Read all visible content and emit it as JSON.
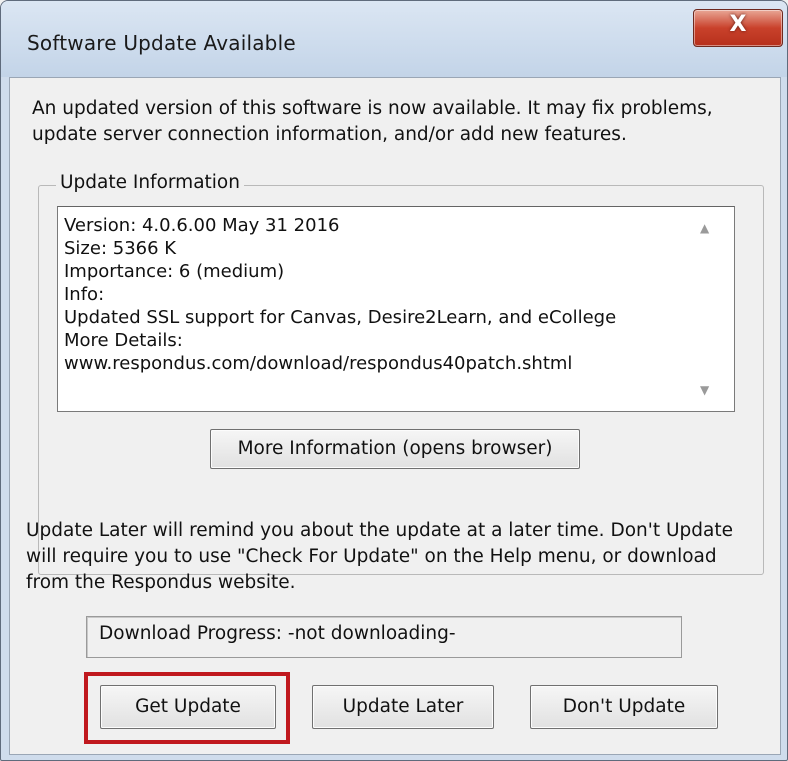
{
  "window": {
    "title": "Software Update Available",
    "close_icon_glyph": "X"
  },
  "intro_text": "An updated version of this software is now available.  It may fix problems, update server connection information, and/or add new features.",
  "intro_lines": [
    "An updated version of this software is now available.  It may fix problems,",
    "update server connection information, and/or add new features."
  ],
  "update_info": {
    "group_label": "Update Information",
    "lines": [
      "Version: 4.0.6.00 May 31 2016",
      "Size: 5366 K",
      "Importance: 6 (medium)",
      "Info:",
      "Updated SSL support for Canvas, Desire2Learn, and eCollege",
      "More Details:",
      "www.respondus.com/download/respondus40patch.shtml"
    ],
    "more_info_button": "More Information (opens browser)"
  },
  "note_lines": [
    "Update Later will remind you about the update at a later time.  Don't Update",
    "will require you to use \"Check For Update\" on the Help menu, or download",
    "from the Respondus website."
  ],
  "progress": {
    "label": "Download Progress:  -not downloading-"
  },
  "buttons": {
    "get_update": "Get Update",
    "update_later": "Update Later",
    "dont_update": "Don't Update"
  },
  "colors": {
    "highlight": "#c0181e",
    "close_button": "#c9412b"
  },
  "icons": {
    "scroll_up": "▲",
    "scroll_down": "▼"
  }
}
